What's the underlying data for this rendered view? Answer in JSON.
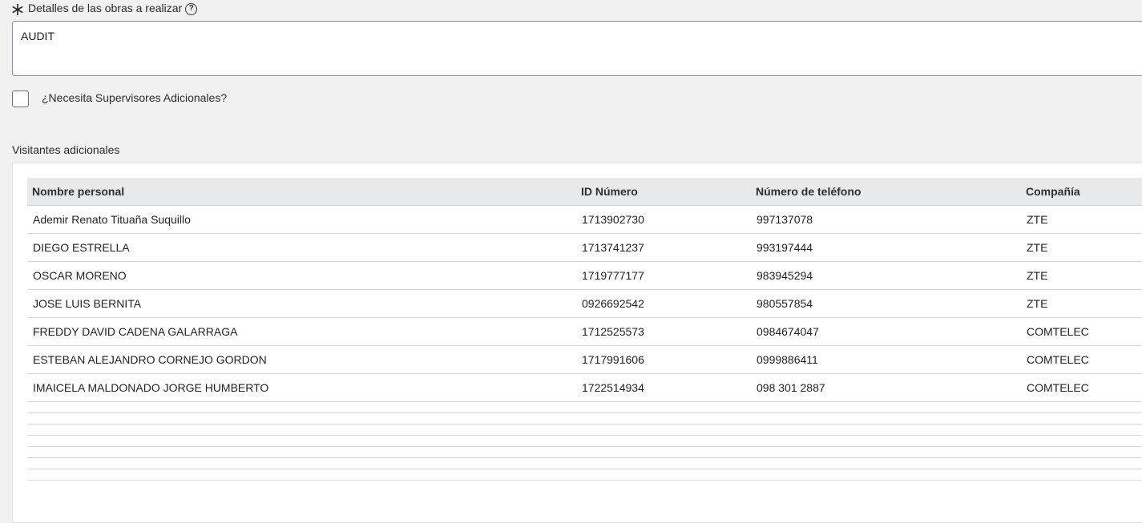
{
  "details": {
    "label": "Detalles de las obras a realizar",
    "help_glyph": "?",
    "value": "AUDIT"
  },
  "supervisors": {
    "label": "¿Necesita Supervisores Adicionales?",
    "checked": false
  },
  "visitors": {
    "section_label": "Visitantes adicionales",
    "columns": [
      "Nombre personal",
      "ID Número",
      "Número de teléfono",
      "Compañía"
    ],
    "rows": [
      {
        "name": "Ademir Renato Tituaña Suquillo",
        "id": "1713902730",
        "phone": "997137078",
        "company": "ZTE"
      },
      {
        "name": "DIEGO ESTRELLA",
        "id": "1713741237",
        "phone": "993197444",
        "company": "ZTE"
      },
      {
        "name": "OSCAR MORENO",
        "id": "1719777177",
        "phone": "983945294",
        "company": "ZTE"
      },
      {
        "name": "JOSE LUIS BERNITA",
        "id": "0926692542",
        "phone": "980557854",
        "company": "ZTE"
      },
      {
        "name": "FREDDY DAVID CADENA GALARRAGA",
        "id": "1712525573",
        "phone": "0984674047",
        "company": "COMTELEC"
      },
      {
        "name": "ESTEBAN ALEJANDRO CORNEJO GORDON",
        "id": "1717991606",
        "phone": "0999886411",
        "company": "COMTELEC"
      },
      {
        "name": "IMAICELA MALDONADO JORGE HUMBERTO",
        "id": "1722514934",
        "phone": "098 301 2887",
        "company": "COMTELEC"
      }
    ]
  }
}
